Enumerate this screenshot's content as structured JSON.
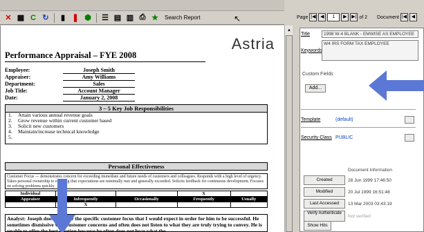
{
  "toolbar": {
    "buttons": [
      {
        "glyph": "✕",
        "icon": "close-icon",
        "color": "red"
      },
      {
        "glyph": "▦",
        "icon": "grid-icon",
        "color": ""
      },
      {
        "glyph": "C",
        "icon": "refresh-icon",
        "color": "grn"
      },
      {
        "glyph": "↻",
        "icon": "redo-icon",
        "color": "blu"
      },
      {
        "glyph": "▮",
        "icon": "bar-icon",
        "color": ""
      },
      {
        "glyph": "❚",
        "icon": "column-icon",
        "color": "red"
      },
      {
        "glyph": "⬢",
        "icon": "shape-icon",
        "color": "grn"
      },
      {
        "glyph": "☰",
        "icon": "list-icon",
        "color": ""
      },
      {
        "glyph": "▤",
        "icon": "table-icon",
        "color": ""
      },
      {
        "glyph": "▥",
        "icon": "panel-icon",
        "color": ""
      },
      {
        "glyph": "⎙",
        "icon": "print-icon",
        "color": ""
      },
      {
        "glyph": "★",
        "icon": "star-icon",
        "color": "grn"
      }
    ],
    "search_report": "Search Report"
  },
  "document": {
    "logo": "Astria",
    "title": "Performance Appraisal – FYE 2008",
    "fields": [
      {
        "label": "Employee:",
        "value": "Joseph Smith"
      },
      {
        "label": "Appraiser:",
        "value": "Amy Williams"
      },
      {
        "label": "Department:",
        "value": "Sales"
      },
      {
        "label": "Job Title:",
        "value": "Account Manager"
      },
      {
        "label": "Date:",
        "value": "January 2, 2008"
      }
    ],
    "resp_title": "3 – 5 Key Job Responsibilities",
    "responsibilities": [
      {
        "n": "1.",
        "text": "Attain various annual revenue goals"
      },
      {
        "n": "2.",
        "text": "Grow revenue within current customer based"
      },
      {
        "n": "3.",
        "text": "Solicit new customers"
      },
      {
        "n": "4.",
        "text": "Maintain/increase technical knowledge"
      },
      {
        "n": "5.",
        "text": ""
      }
    ],
    "pe_title": "Personal Effectiveness",
    "customer_focus": "Customer Focus — demonstrates concern for exceeding immediate and future needs of customers and colleagues. Responds with a high level of urgency. Takes personal ownership to ensuring that expectations are minimally met and generally exceeded. Solicits feedback for continuous development. Focuses on solving problems quickly.",
    "rating_headers": [
      "Individual",
      "",
      "",
      "X",
      "",
      ""
    ],
    "rating_cols": [
      "Appraiser",
      "Infrequently",
      "Occasionally",
      "Frequently",
      "Usually"
    ],
    "rating_marks": [
      "",
      "X",
      "",
      "",
      ""
    ],
    "analyst": "Analyst: Joseph does not have the specific customer focus that I would expect in order for him to be successful. He sometimes dismissive with customer concerns and often does not listen to what they are truly trying to convey. He is unable to offer the best solution because he often does not hear what the"
  },
  "nav": {
    "page_label": "Page",
    "page_num": "1",
    "of_label": "of 2",
    "doc_label": "Document"
  },
  "panel": {
    "title_label": "Title",
    "title_value": "1998 W-4 BLANK - EMWISE AS EMPLOYEE",
    "keywords_label": "Keywords",
    "keywords_value": "W4 IRS FORM TAX EMPLOYEE",
    "custom_fields": "Custom Fields",
    "add": "Add...",
    "template_label": "Template",
    "template_value": "(default)",
    "security_label": "Security Class",
    "security_value": "PUBLIC",
    "doc_info_title": "Document Information",
    "info": [
      {
        "button": "Created",
        "value": "28 Jun 1999 17:46:50"
      },
      {
        "button": "Modified",
        "value": "20 Jul 1999 16:51:48"
      },
      {
        "button": "Last Accessed",
        "value": "13 Mar 2003 03:43:19"
      },
      {
        "button": "Verify Authenticate",
        "value": "Not verified"
      }
    ],
    "show_hits": "Show Hits"
  },
  "colors": {
    "accent_arrow": "#5b78d6",
    "link": "#1040c0"
  }
}
